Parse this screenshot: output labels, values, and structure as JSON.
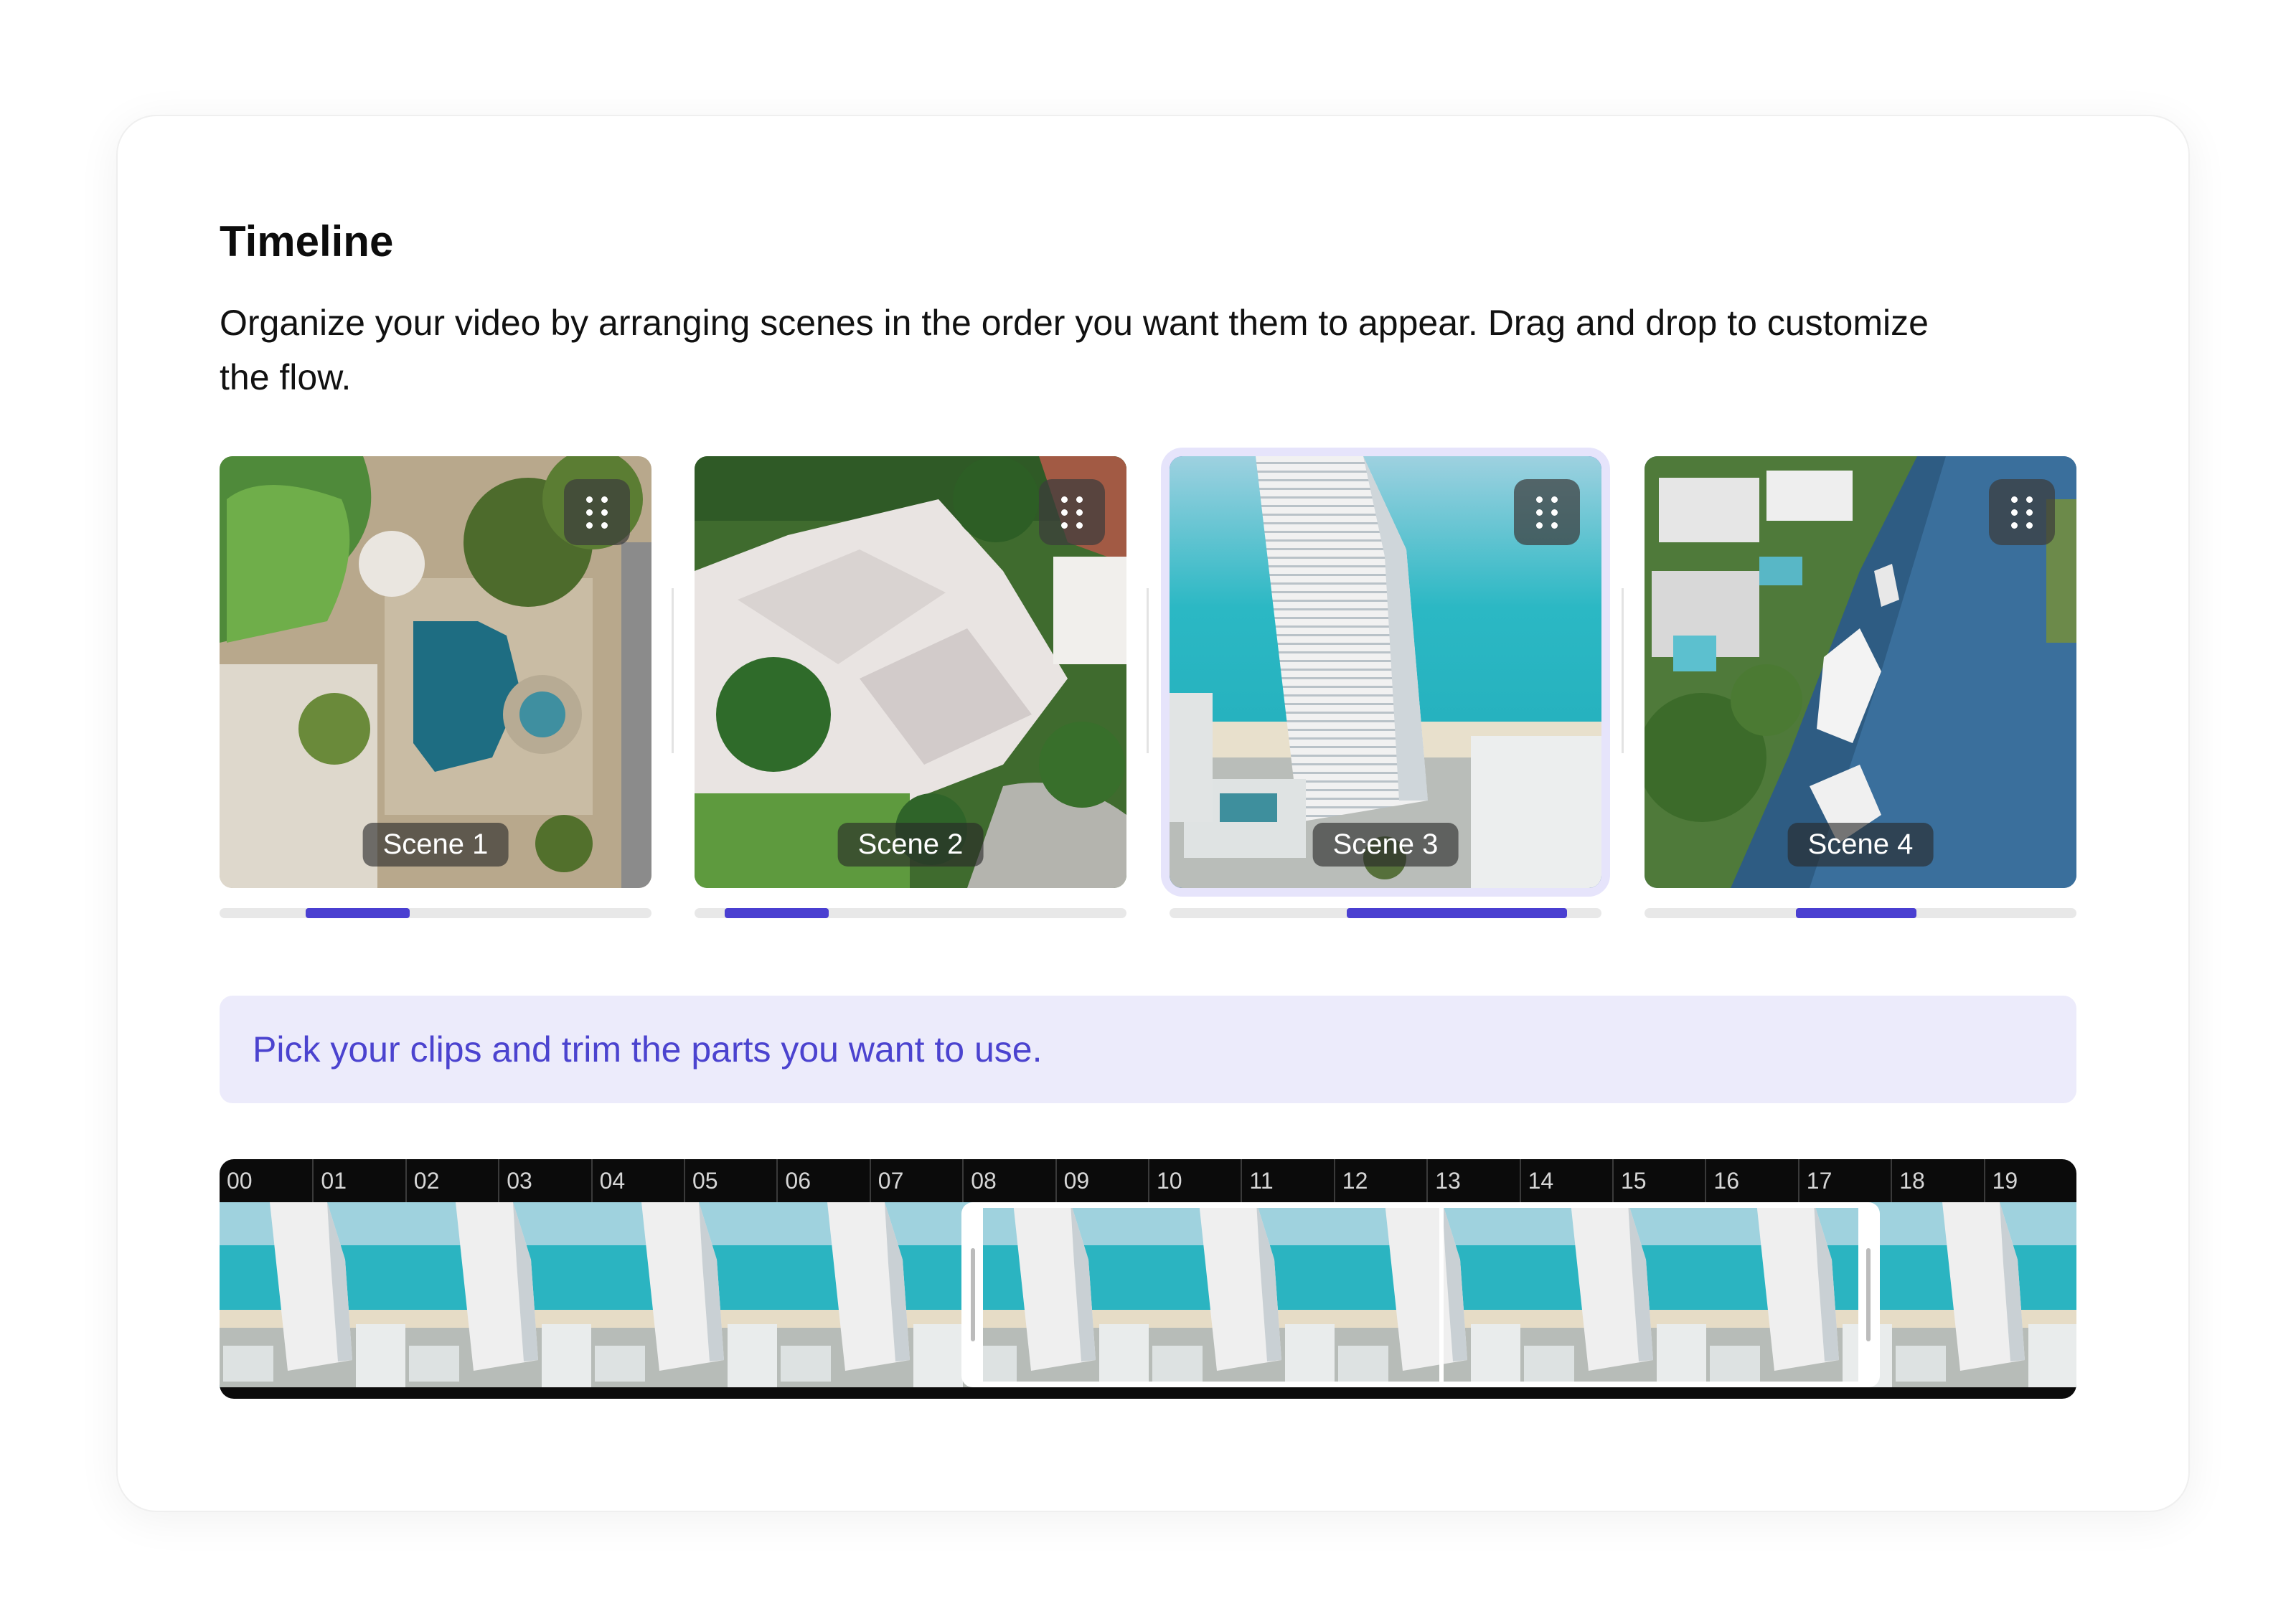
{
  "timeline": {
    "title": "Timeline",
    "description": "Organize your video by arranging scenes in the order you want them to appear. Drag and drop to customize the flow."
  },
  "scenes": [
    {
      "label": "Scene 1",
      "trim_start": 0.2,
      "trim_end": 0.44,
      "selected": false
    },
    {
      "label": "Scene 2",
      "trim_start": 0.07,
      "trim_end": 0.31,
      "selected": false
    },
    {
      "label": "Scene 3",
      "trim_start": 0.41,
      "trim_end": 0.92,
      "selected": true
    },
    {
      "label": "Scene 4",
      "trim_start": 0.35,
      "trim_end": 0.63,
      "selected": false
    }
  ],
  "hint": "Pick your clips and trim the parts you want to use.",
  "ruler": [
    "00",
    "01",
    "02",
    "03",
    "04",
    "05",
    "06",
    "07",
    "08",
    "09",
    "10",
    "11",
    "12",
    "13",
    "14",
    "15",
    "16",
    "17",
    "18",
    "19"
  ],
  "colors": {
    "accent": "#4a3fd1",
    "hint_bg": "#ecebfb",
    "hint_text": "#4b43cf"
  }
}
